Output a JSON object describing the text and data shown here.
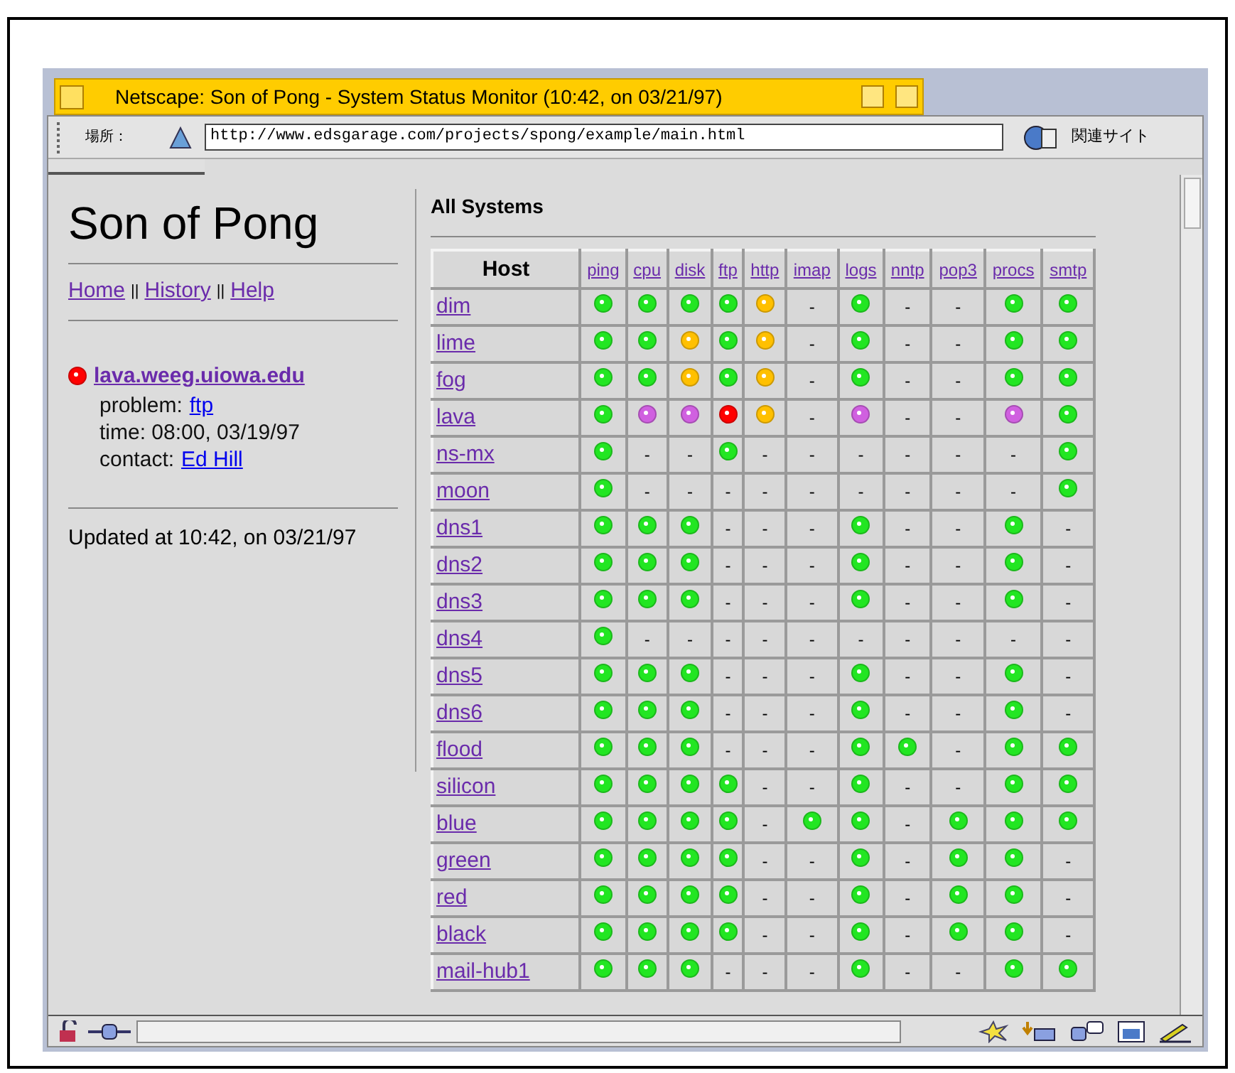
{
  "window": {
    "title": "Netscape: Son of Pong - System Status Monitor (10:42, on 03/21/97)"
  },
  "toolbar": {
    "location_label": "場所：",
    "url": "http://www.edsgarage.com/projects/spong/example/main.html",
    "related": "関連サイト"
  },
  "sidebar": {
    "title": "Son of Pong",
    "nav": [
      {
        "kind": "link",
        "text": "Home"
      },
      {
        "kind": "sep",
        "text": "||"
      },
      {
        "kind": "link",
        "text": "History"
      },
      {
        "kind": "sep",
        "text": "||"
      },
      {
        "kind": "link",
        "text": "Help"
      }
    ],
    "alert": {
      "color": "#ff0000",
      "host": "lava.weeg.uiowa.edu",
      "problem_label": "problem:",
      "problem": "ftp",
      "time": "time: 08:00, 03/19/97",
      "contact_label": "contact:",
      "contact": "Ed Hill"
    },
    "updated": "Updated at 10:42, on 03/21/97"
  },
  "main": {
    "title": "All Systems",
    "columns": [
      "Host",
      "ping",
      "cpu",
      "disk",
      "ftp",
      "http",
      "imap",
      "logs",
      "nntp",
      "pop3",
      "procs",
      "smtp"
    ],
    "rows": [
      {
        "cells": [
          {
            "kind": "host",
            "text": "dim"
          },
          {
            "kind": "dot",
            "color": "#22e622"
          },
          {
            "kind": "dot",
            "color": "#22e622"
          },
          {
            "kind": "dot",
            "color": "#22e622"
          },
          {
            "kind": "dot",
            "color": "#22e622"
          },
          {
            "kind": "dot",
            "color": "#ffc000"
          },
          {
            "kind": "dash",
            "text": "-"
          },
          {
            "kind": "dot",
            "color": "#22e622"
          },
          {
            "kind": "dash",
            "text": "-"
          },
          {
            "kind": "dash",
            "text": "-"
          },
          {
            "kind": "dot",
            "color": "#22e622"
          },
          {
            "kind": "dot",
            "color": "#22e622"
          }
        ]
      },
      {
        "cells": [
          {
            "kind": "host",
            "text": "lime"
          },
          {
            "kind": "dot",
            "color": "#22e622"
          },
          {
            "kind": "dot",
            "color": "#22e622"
          },
          {
            "kind": "dot",
            "color": "#ffc000"
          },
          {
            "kind": "dot",
            "color": "#22e622"
          },
          {
            "kind": "dot",
            "color": "#ffc000"
          },
          {
            "kind": "dash",
            "text": "-"
          },
          {
            "kind": "dot",
            "color": "#22e622"
          },
          {
            "kind": "dash",
            "text": "-"
          },
          {
            "kind": "dash",
            "text": "-"
          },
          {
            "kind": "dot",
            "color": "#22e622"
          },
          {
            "kind": "dot",
            "color": "#22e622"
          }
        ]
      },
      {
        "cells": [
          {
            "kind": "host",
            "text": "fog"
          },
          {
            "kind": "dot",
            "color": "#22e622"
          },
          {
            "kind": "dot",
            "color": "#22e622"
          },
          {
            "kind": "dot",
            "color": "#ffc000"
          },
          {
            "kind": "dot",
            "color": "#22e622"
          },
          {
            "kind": "dot",
            "color": "#ffc000"
          },
          {
            "kind": "dash",
            "text": "-"
          },
          {
            "kind": "dot",
            "color": "#22e622"
          },
          {
            "kind": "dash",
            "text": "-"
          },
          {
            "kind": "dash",
            "text": "-"
          },
          {
            "kind": "dot",
            "color": "#22e622"
          },
          {
            "kind": "dot",
            "color": "#22e622"
          }
        ]
      },
      {
        "cells": [
          {
            "kind": "host",
            "text": "lava"
          },
          {
            "kind": "dot",
            "color": "#22e622"
          },
          {
            "kind": "dot",
            "color": "#d060e0"
          },
          {
            "kind": "dot",
            "color": "#d060e0"
          },
          {
            "kind": "dot",
            "color": "#ff0000"
          },
          {
            "kind": "dot",
            "color": "#ffc000"
          },
          {
            "kind": "dash",
            "text": "-"
          },
          {
            "kind": "dot",
            "color": "#d060e0"
          },
          {
            "kind": "dash",
            "text": "-"
          },
          {
            "kind": "dash",
            "text": "-"
          },
          {
            "kind": "dot",
            "color": "#d060e0"
          },
          {
            "kind": "dot",
            "color": "#22e622"
          }
        ]
      },
      {
        "cells": [
          {
            "kind": "host",
            "text": "ns-mx"
          },
          {
            "kind": "dot",
            "color": "#22e622"
          },
          {
            "kind": "dash",
            "text": "-"
          },
          {
            "kind": "dash",
            "text": "-"
          },
          {
            "kind": "dot",
            "color": "#22e622"
          },
          {
            "kind": "dash",
            "text": "-"
          },
          {
            "kind": "dash",
            "text": "-"
          },
          {
            "kind": "dash",
            "text": "-"
          },
          {
            "kind": "dash",
            "text": "-"
          },
          {
            "kind": "dash",
            "text": "-"
          },
          {
            "kind": "dash",
            "text": "-"
          },
          {
            "kind": "dot",
            "color": "#22e622"
          }
        ]
      },
      {
        "cells": [
          {
            "kind": "host",
            "text": "moon"
          },
          {
            "kind": "dot",
            "color": "#22e622"
          },
          {
            "kind": "dash",
            "text": "-"
          },
          {
            "kind": "dash",
            "text": "-"
          },
          {
            "kind": "dash",
            "text": "-"
          },
          {
            "kind": "dash",
            "text": "-"
          },
          {
            "kind": "dash",
            "text": "-"
          },
          {
            "kind": "dash",
            "text": "-"
          },
          {
            "kind": "dash",
            "text": "-"
          },
          {
            "kind": "dash",
            "text": "-"
          },
          {
            "kind": "dash",
            "text": "-"
          },
          {
            "kind": "dot",
            "color": "#22e622"
          }
        ]
      },
      {
        "cells": [
          {
            "kind": "host",
            "text": "dns1"
          },
          {
            "kind": "dot",
            "color": "#22e622"
          },
          {
            "kind": "dot",
            "color": "#22e622"
          },
          {
            "kind": "dot",
            "color": "#22e622"
          },
          {
            "kind": "dash",
            "text": "-"
          },
          {
            "kind": "dash",
            "text": "-"
          },
          {
            "kind": "dash",
            "text": "-"
          },
          {
            "kind": "dot",
            "color": "#22e622"
          },
          {
            "kind": "dash",
            "text": "-"
          },
          {
            "kind": "dash",
            "text": "-"
          },
          {
            "kind": "dot",
            "color": "#22e622"
          },
          {
            "kind": "dash",
            "text": "-"
          }
        ]
      },
      {
        "cells": [
          {
            "kind": "host",
            "text": "dns2"
          },
          {
            "kind": "dot",
            "color": "#22e622"
          },
          {
            "kind": "dot",
            "color": "#22e622"
          },
          {
            "kind": "dot",
            "color": "#22e622"
          },
          {
            "kind": "dash",
            "text": "-"
          },
          {
            "kind": "dash",
            "text": "-"
          },
          {
            "kind": "dash",
            "text": "-"
          },
          {
            "kind": "dot",
            "color": "#22e622"
          },
          {
            "kind": "dash",
            "text": "-"
          },
          {
            "kind": "dash",
            "text": "-"
          },
          {
            "kind": "dot",
            "color": "#22e622"
          },
          {
            "kind": "dash",
            "text": "-"
          }
        ]
      },
      {
        "cells": [
          {
            "kind": "host",
            "text": "dns3"
          },
          {
            "kind": "dot",
            "color": "#22e622"
          },
          {
            "kind": "dot",
            "color": "#22e622"
          },
          {
            "kind": "dot",
            "color": "#22e622"
          },
          {
            "kind": "dash",
            "text": "-"
          },
          {
            "kind": "dash",
            "text": "-"
          },
          {
            "kind": "dash",
            "text": "-"
          },
          {
            "kind": "dot",
            "color": "#22e622"
          },
          {
            "kind": "dash",
            "text": "-"
          },
          {
            "kind": "dash",
            "text": "-"
          },
          {
            "kind": "dot",
            "color": "#22e622"
          },
          {
            "kind": "dash",
            "text": "-"
          }
        ]
      },
      {
        "cells": [
          {
            "kind": "host",
            "text": "dns4"
          },
          {
            "kind": "dot",
            "color": "#22e622"
          },
          {
            "kind": "dash",
            "text": "-"
          },
          {
            "kind": "dash",
            "text": "-"
          },
          {
            "kind": "dash",
            "text": "-"
          },
          {
            "kind": "dash",
            "text": "-"
          },
          {
            "kind": "dash",
            "text": "-"
          },
          {
            "kind": "dash",
            "text": "-"
          },
          {
            "kind": "dash",
            "text": "-"
          },
          {
            "kind": "dash",
            "text": "-"
          },
          {
            "kind": "dash",
            "text": "-"
          },
          {
            "kind": "dash",
            "text": "-"
          }
        ]
      },
      {
        "cells": [
          {
            "kind": "host",
            "text": "dns5"
          },
          {
            "kind": "dot",
            "color": "#22e622"
          },
          {
            "kind": "dot",
            "color": "#22e622"
          },
          {
            "kind": "dot",
            "color": "#22e622"
          },
          {
            "kind": "dash",
            "text": "-"
          },
          {
            "kind": "dash",
            "text": "-"
          },
          {
            "kind": "dash",
            "text": "-"
          },
          {
            "kind": "dot",
            "color": "#22e622"
          },
          {
            "kind": "dash",
            "text": "-"
          },
          {
            "kind": "dash",
            "text": "-"
          },
          {
            "kind": "dot",
            "color": "#22e622"
          },
          {
            "kind": "dash",
            "text": "-"
          }
        ]
      },
      {
        "cells": [
          {
            "kind": "host",
            "text": "dns6"
          },
          {
            "kind": "dot",
            "color": "#22e622"
          },
          {
            "kind": "dot",
            "color": "#22e622"
          },
          {
            "kind": "dot",
            "color": "#22e622"
          },
          {
            "kind": "dash",
            "text": "-"
          },
          {
            "kind": "dash",
            "text": "-"
          },
          {
            "kind": "dash",
            "text": "-"
          },
          {
            "kind": "dot",
            "color": "#22e622"
          },
          {
            "kind": "dash",
            "text": "-"
          },
          {
            "kind": "dash",
            "text": "-"
          },
          {
            "kind": "dot",
            "color": "#22e622"
          },
          {
            "kind": "dash",
            "text": "-"
          }
        ]
      },
      {
        "cells": [
          {
            "kind": "host",
            "text": "flood"
          },
          {
            "kind": "dot",
            "color": "#22e622"
          },
          {
            "kind": "dot",
            "color": "#22e622"
          },
          {
            "kind": "dot",
            "color": "#22e622"
          },
          {
            "kind": "dash",
            "text": "-"
          },
          {
            "kind": "dash",
            "text": "-"
          },
          {
            "kind": "dash",
            "text": "-"
          },
          {
            "kind": "dot",
            "color": "#22e622"
          },
          {
            "kind": "dot",
            "color": "#22e622"
          },
          {
            "kind": "dash",
            "text": "-"
          },
          {
            "kind": "dot",
            "color": "#22e622"
          },
          {
            "kind": "dot",
            "color": "#22e622"
          }
        ]
      },
      {
        "cells": [
          {
            "kind": "host",
            "text": "silicon"
          },
          {
            "kind": "dot",
            "color": "#22e622"
          },
          {
            "kind": "dot",
            "color": "#22e622"
          },
          {
            "kind": "dot",
            "color": "#22e622"
          },
          {
            "kind": "dot",
            "color": "#22e622"
          },
          {
            "kind": "dash",
            "text": "-"
          },
          {
            "kind": "dash",
            "text": "-"
          },
          {
            "kind": "dot",
            "color": "#22e622"
          },
          {
            "kind": "dash",
            "text": "-"
          },
          {
            "kind": "dash",
            "text": "-"
          },
          {
            "kind": "dot",
            "color": "#22e622"
          },
          {
            "kind": "dot",
            "color": "#22e622"
          }
        ]
      },
      {
        "cells": [
          {
            "kind": "host",
            "text": "blue"
          },
          {
            "kind": "dot",
            "color": "#22e622"
          },
          {
            "kind": "dot",
            "color": "#22e622"
          },
          {
            "kind": "dot",
            "color": "#22e622"
          },
          {
            "kind": "dot",
            "color": "#22e622"
          },
          {
            "kind": "dash",
            "text": "-"
          },
          {
            "kind": "dot",
            "color": "#22e622"
          },
          {
            "kind": "dot",
            "color": "#22e622"
          },
          {
            "kind": "dash",
            "text": "-"
          },
          {
            "kind": "dot",
            "color": "#22e622"
          },
          {
            "kind": "dot",
            "color": "#22e622"
          },
          {
            "kind": "dot",
            "color": "#22e622"
          }
        ]
      },
      {
        "cells": [
          {
            "kind": "host",
            "text": "green"
          },
          {
            "kind": "dot",
            "color": "#22e622"
          },
          {
            "kind": "dot",
            "color": "#22e622"
          },
          {
            "kind": "dot",
            "color": "#22e622"
          },
          {
            "kind": "dot",
            "color": "#22e622"
          },
          {
            "kind": "dash",
            "text": "-"
          },
          {
            "kind": "dash",
            "text": "-"
          },
          {
            "kind": "dot",
            "color": "#22e622"
          },
          {
            "kind": "dash",
            "text": "-"
          },
          {
            "kind": "dot",
            "color": "#22e622"
          },
          {
            "kind": "dot",
            "color": "#22e622"
          },
          {
            "kind": "dash",
            "text": "-"
          }
        ]
      },
      {
        "cells": [
          {
            "kind": "host",
            "text": "red"
          },
          {
            "kind": "dot",
            "color": "#22e622"
          },
          {
            "kind": "dot",
            "color": "#22e622"
          },
          {
            "kind": "dot",
            "color": "#22e622"
          },
          {
            "kind": "dot",
            "color": "#22e622"
          },
          {
            "kind": "dash",
            "text": "-"
          },
          {
            "kind": "dash",
            "text": "-"
          },
          {
            "kind": "dot",
            "color": "#22e622"
          },
          {
            "kind": "dash",
            "text": "-"
          },
          {
            "kind": "dot",
            "color": "#22e622"
          },
          {
            "kind": "dot",
            "color": "#22e622"
          },
          {
            "kind": "dash",
            "text": "-"
          }
        ]
      },
      {
        "cells": [
          {
            "kind": "host",
            "text": "black"
          },
          {
            "kind": "dot",
            "color": "#22e622"
          },
          {
            "kind": "dot",
            "color": "#22e622"
          },
          {
            "kind": "dot",
            "color": "#22e622"
          },
          {
            "kind": "dot",
            "color": "#22e622"
          },
          {
            "kind": "dash",
            "text": "-"
          },
          {
            "kind": "dash",
            "text": "-"
          },
          {
            "kind": "dot",
            "color": "#22e622"
          },
          {
            "kind": "dash",
            "text": "-"
          },
          {
            "kind": "dot",
            "color": "#22e622"
          },
          {
            "kind": "dot",
            "color": "#22e622"
          },
          {
            "kind": "dash",
            "text": "-"
          }
        ]
      },
      {
        "cells": [
          {
            "kind": "host",
            "text": "mail-hub1"
          },
          {
            "kind": "dot",
            "color": "#22e622"
          },
          {
            "kind": "dot",
            "color": "#22e622"
          },
          {
            "kind": "dot",
            "color": "#22e622"
          },
          {
            "kind": "dash",
            "text": "-"
          },
          {
            "kind": "dash",
            "text": "-"
          },
          {
            "kind": "dash",
            "text": "-"
          },
          {
            "kind": "dot",
            "color": "#22e622"
          },
          {
            "kind": "dash",
            "text": "-"
          },
          {
            "kind": "dash",
            "text": "-"
          },
          {
            "kind": "dot",
            "color": "#22e622"
          },
          {
            "kind": "dot",
            "color": "#22e622"
          }
        ]
      }
    ]
  }
}
